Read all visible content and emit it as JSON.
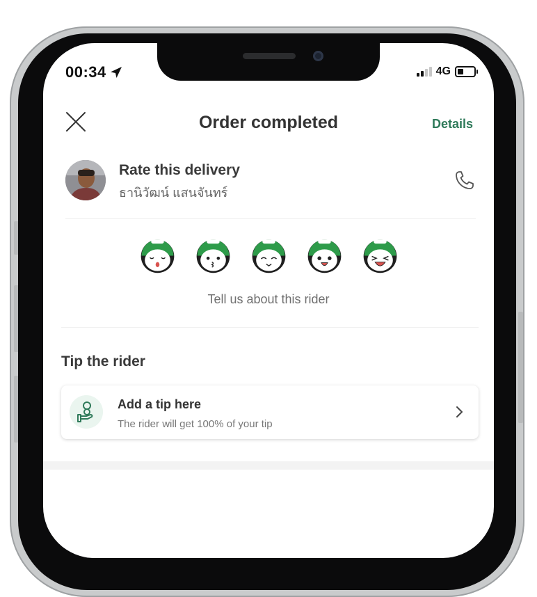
{
  "status_bar": {
    "time": "00:34",
    "network": "4G"
  },
  "header": {
    "title": "Order completed",
    "details_label": "Details"
  },
  "rider": {
    "rate_label": "Rate this delivery",
    "name": "ธานิวัฒน์ แสนจันทร์"
  },
  "rating": {
    "prompt": "Tell us about this rider",
    "max_score": 5
  },
  "tip": {
    "heading": "Tip the rider",
    "card_title": "Add a tip here",
    "card_subtitle": "The rider will get 100% of your tip"
  },
  "colors": {
    "brand_green": "#2f7a5a",
    "helmet_green": "#2e9b4a"
  }
}
